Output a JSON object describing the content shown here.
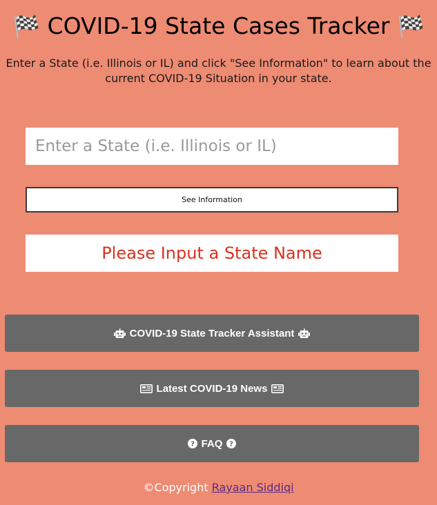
{
  "header": {
    "title": "COVID-19 State Cases Tracker",
    "left_icon": "flag-icon",
    "right_icon": "flag-icon"
  },
  "intro": {
    "text": "Enter a State (i.e. Illinois or IL) and click \"See Information\" to learn about the current COVID-19 Situation in your state."
  },
  "search": {
    "placeholder": "Enter a State (i.e. Illinois or IL)",
    "value": "",
    "button_label": "See Information"
  },
  "result": {
    "message": "Please Input a State Name",
    "color": "#d8321e"
  },
  "nav_buttons": [
    {
      "label": "COVID-19 State Tracker Assistant",
      "icon": "robot-icon"
    },
    {
      "label": "Latest COVID-19 News",
      "icon": "newspaper-icon"
    },
    {
      "label": "FAQ",
      "icon": "question-circle-icon"
    }
  ],
  "footer": {
    "copyright": "©Copyright",
    "author_link": "Rayaan Siddiqi"
  },
  "colors": {
    "background": "#ee8b73",
    "button_gray": "#686868",
    "link_purple": "#5b2a86"
  }
}
